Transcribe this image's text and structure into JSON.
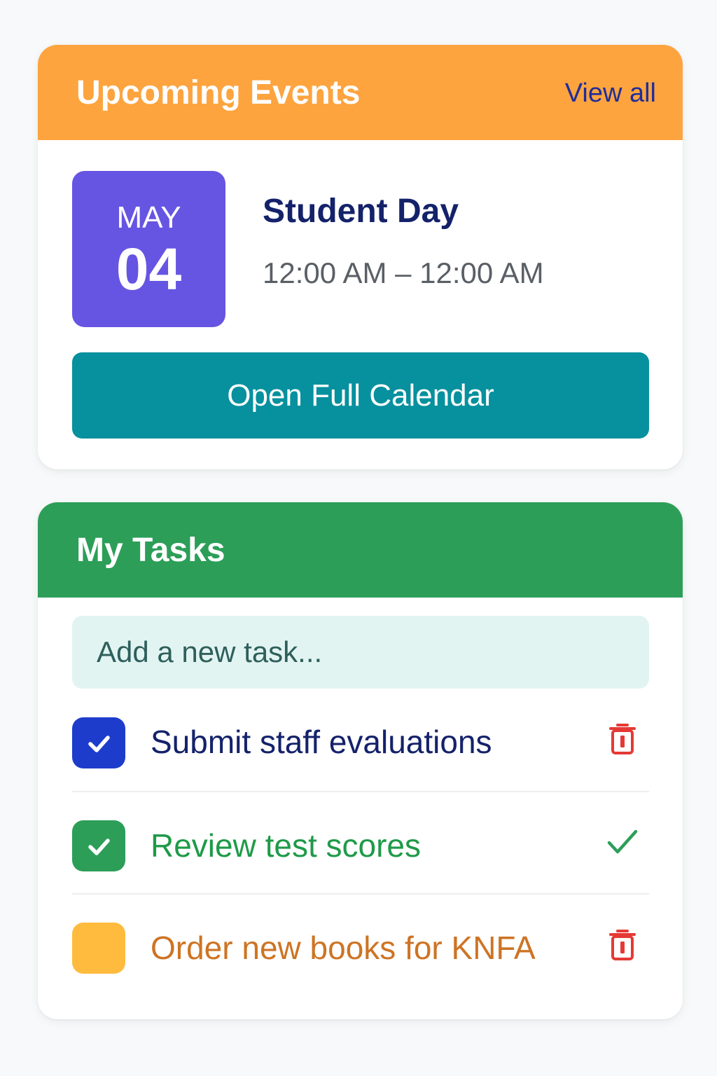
{
  "colors": {
    "events_header": "#fda43f",
    "tasks_header": "#2c9e58",
    "date_tile": "#6655e2",
    "calendar_button": "#07909e",
    "view_all": "#1f2d9a",
    "delete_icon": "#e53935"
  },
  "events": {
    "title": "Upcoming Events",
    "view_all": "View all",
    "event": {
      "month": "MAY",
      "day": "04",
      "title": "Student Day",
      "time": "12:00 AM – 12:00 AM"
    },
    "open_calendar": "Open Full Calendar"
  },
  "tasks": {
    "title": "My Tasks",
    "new_task_placeholder": "Add a new task...",
    "items": [
      {
        "label": "Submit staff evaluations",
        "checked": true,
        "checkbox_color": "#1e3ccc",
        "text_color": "#14226a",
        "action_icon": "trash-icon"
      },
      {
        "label": "Review test scores",
        "checked": true,
        "checkbox_color": "#2c9e58",
        "text_color": "#1f9a48",
        "action_icon": "checkmark-icon"
      },
      {
        "label": "Order new books for KNFA",
        "checked": false,
        "checkbox_color": "#ffbb3d",
        "text_color": "#cd7424",
        "action_icon": "trash-icon"
      }
    ]
  }
}
